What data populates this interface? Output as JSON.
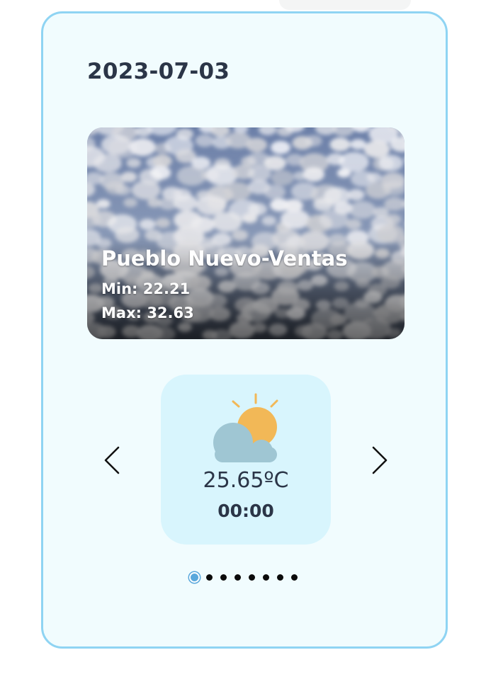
{
  "date": "2023-07-03",
  "location": {
    "city": "Pueblo Nuevo-Ventas",
    "min_label": "Min: 22.21",
    "max_label": "Max: 32.63"
  },
  "carousel": {
    "current_slide": {
      "temperature": "25.65ºC",
      "time": "00:00",
      "icon": "partly-cloudy-icon"
    },
    "total_slides": 8,
    "active_index": 0
  },
  "colors": {
    "card_background": "#f1fcfe",
    "card_border": "#8fd4f3",
    "slide_background": "#d8f5fd",
    "text_dark": "#2b3547",
    "active_dot": "#5aa8dc",
    "sun": "#f2b857",
    "cloud": "#9fc6d3"
  }
}
